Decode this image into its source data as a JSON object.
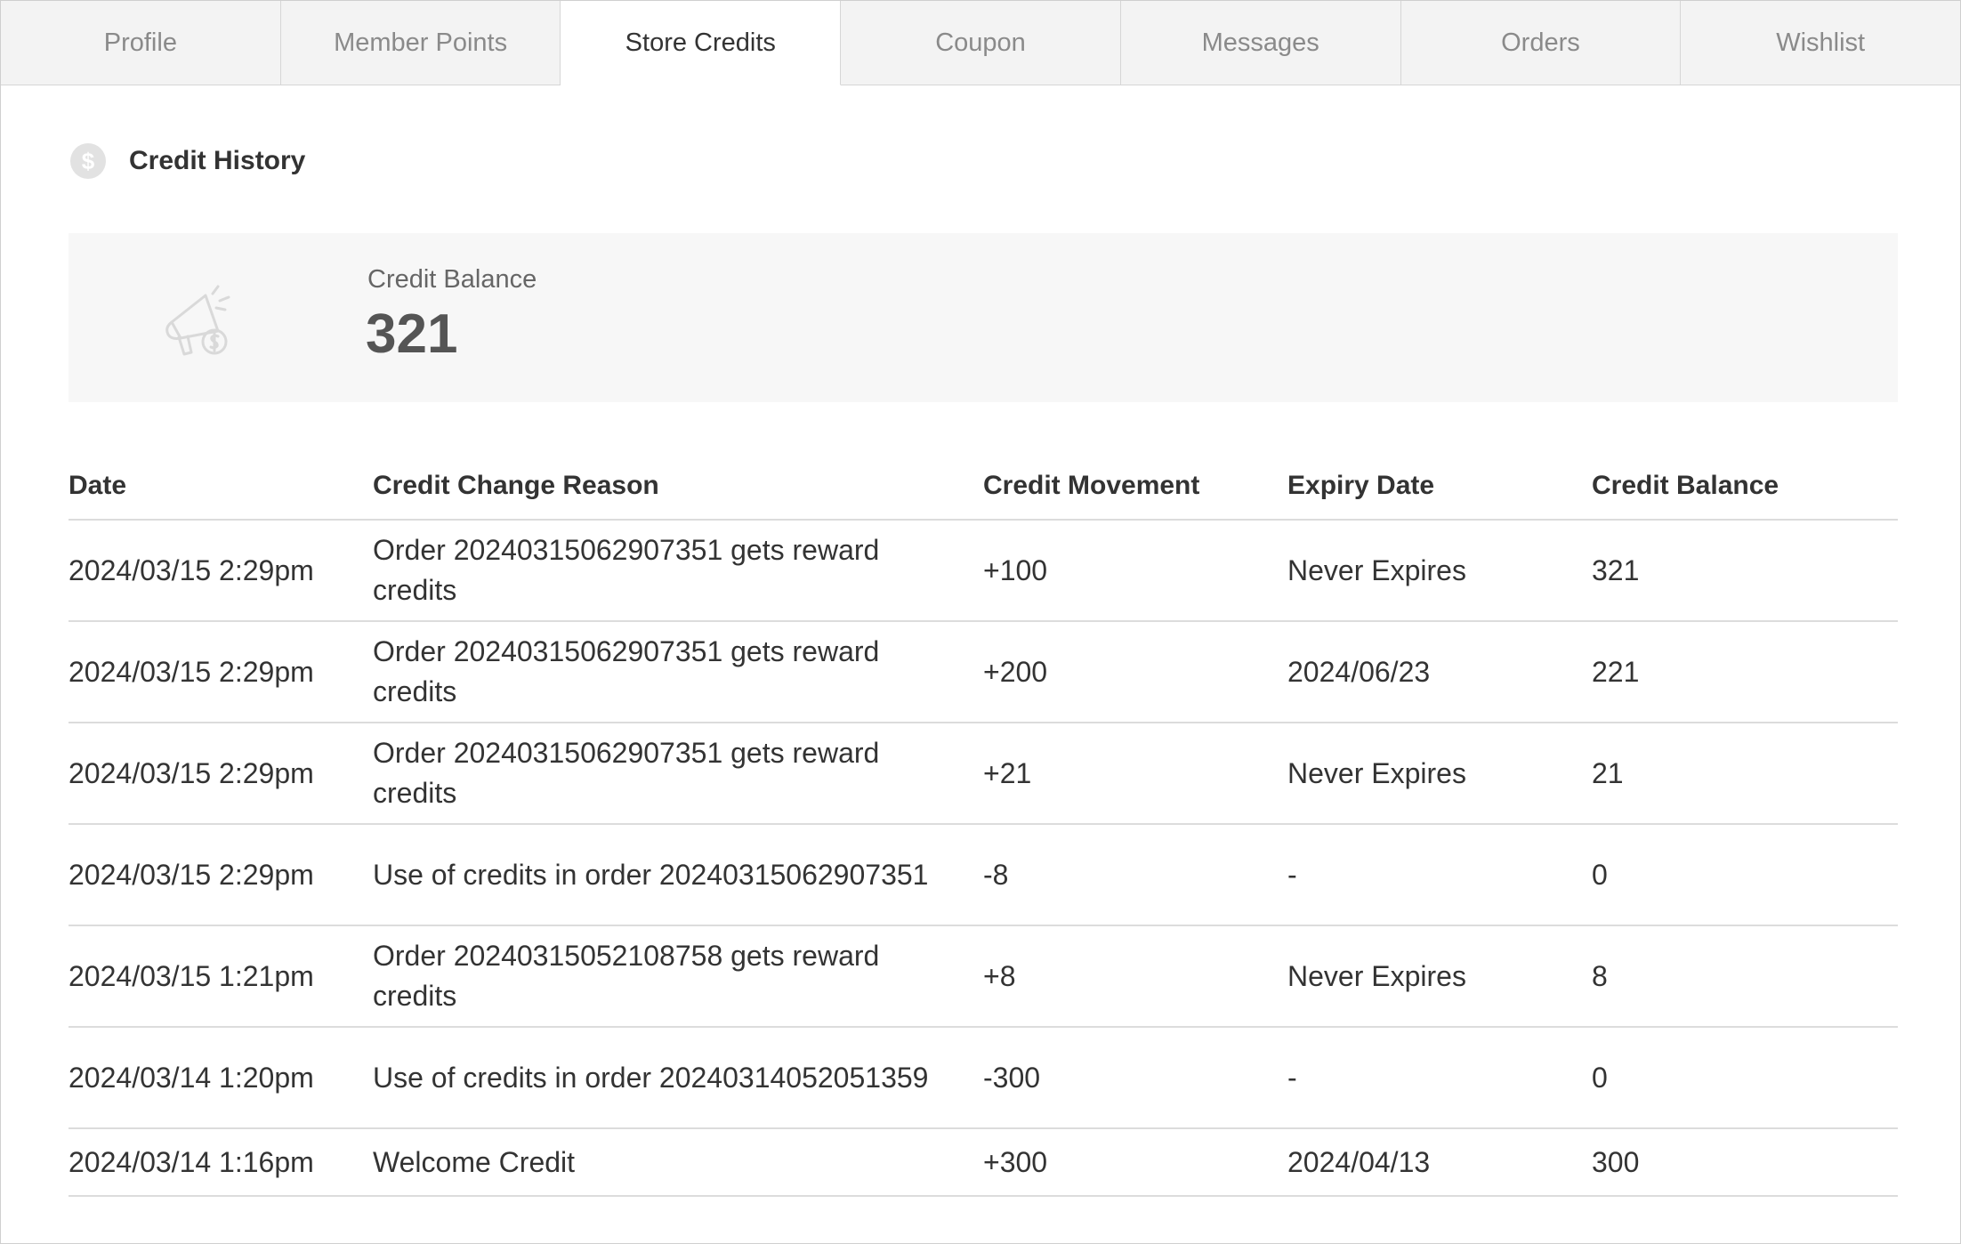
{
  "tabs": [
    {
      "label": "Profile",
      "active": false
    },
    {
      "label": "Member Points",
      "active": false
    },
    {
      "label": "Store Credits",
      "active": true
    },
    {
      "label": "Coupon",
      "active": false
    },
    {
      "label": "Messages",
      "active": false
    },
    {
      "label": "Orders",
      "active": false
    },
    {
      "label": "Wishlist",
      "active": false
    }
  ],
  "section": {
    "icon": "dollar-circle-icon",
    "icon_glyph": "$",
    "title": "Credit History"
  },
  "balance_card": {
    "icon": "megaphone-dollar-icon",
    "label": "Credit Balance",
    "value": "321"
  },
  "table": {
    "headers": [
      "Date",
      "Credit Change Reason",
      "Credit Movement",
      "Expiry Date",
      "Credit Balance"
    ],
    "rows": [
      {
        "date": "2024/03/15 2:29pm",
        "reason": "Order  20240315062907351  gets reward credits",
        "movement": "+100",
        "expiry": "Never Expires",
        "balance": "321"
      },
      {
        "date": "2024/03/15 2:29pm",
        "reason": "Order  20240315062907351  gets reward credits",
        "movement": "+200",
        "expiry": "2024/06/23",
        "balance": "221"
      },
      {
        "date": "2024/03/15 2:29pm",
        "reason": "Order  20240315062907351  gets reward credits",
        "movement": "+21",
        "expiry": "Never Expires",
        "balance": "21"
      },
      {
        "date": "2024/03/15 2:29pm",
        "reason": "Use of credits in order 20240315062907351",
        "movement": "-8",
        "expiry": "-",
        "balance": "0"
      },
      {
        "date": "2024/03/15 1:21pm",
        "reason": "Order  20240315052108758  gets reward credits",
        "movement": "+8",
        "expiry": "Never Expires",
        "balance": "8"
      },
      {
        "date": "2024/03/14 1:20pm",
        "reason": "Use of credits in order 20240314052051359",
        "movement": "-300",
        "expiry": "-",
        "balance": "0"
      },
      {
        "date": "2024/03/14 1:16pm",
        "reason": "Welcome Credit",
        "movement": "+300",
        "expiry": "2024/04/13",
        "balance": "300"
      }
    ]
  },
  "colors": {
    "positive": "#6aaa4a",
    "negative": "#b23a30"
  }
}
